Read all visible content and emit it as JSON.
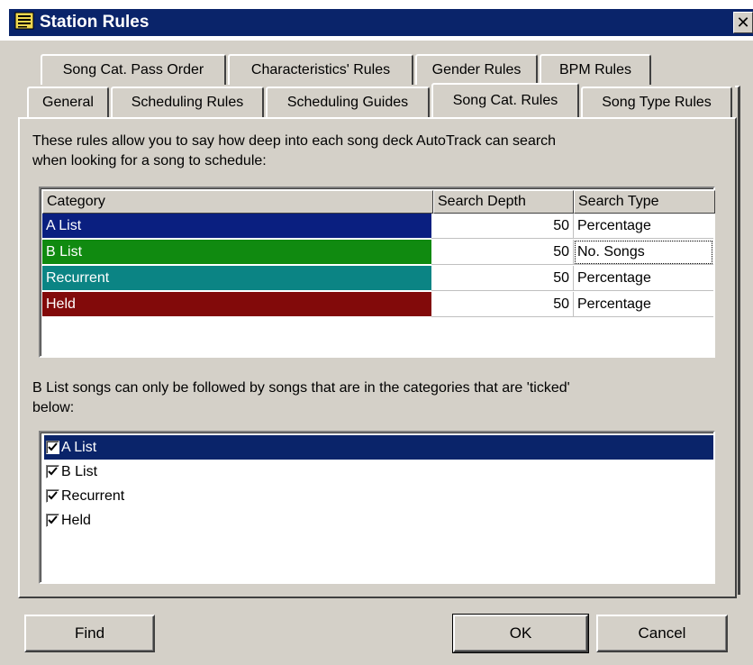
{
  "window": {
    "title": "Station Rules",
    "close_glyph": "✕"
  },
  "tabs_row1": [
    {
      "label": "Song Cat. Pass Order"
    },
    {
      "label": "Characteristics' Rules"
    },
    {
      "label": "Gender Rules"
    },
    {
      "label": "BPM Rules"
    }
  ],
  "tabs_row2": [
    {
      "label": "General"
    },
    {
      "label": "Scheduling Rules"
    },
    {
      "label": "Scheduling Guides"
    },
    {
      "label": "Song Cat. Rules",
      "active": true
    },
    {
      "label": "Song Type Rules"
    }
  ],
  "panel": {
    "description_line1": "These rules allow you to say how deep into each song deck AutoTrack can search",
    "description_line2": "when looking for a song to schedule:",
    "grid": {
      "columns": [
        "Category",
        "Search Depth",
        "Search Type"
      ],
      "rows": [
        {
          "category": "A List",
          "depth": "50",
          "type": "Percentage",
          "color": "#0a1f80"
        },
        {
          "category": "B List",
          "depth": "50",
          "type": "No. Songs",
          "color": "#108a10"
        },
        {
          "category": "Recurrent",
          "depth": "50",
          "type": "Percentage",
          "color": "#0b8484"
        },
        {
          "category": "Held",
          "depth": "50",
          "type": "Percentage",
          "color": "#820a0a"
        }
      ]
    },
    "follow_text_line1": "B List songs can only be followed by songs that are in the categories that are 'ticked'",
    "follow_text_line2": "below:",
    "follow_list": [
      {
        "label": "A List",
        "checked": true,
        "selected": true
      },
      {
        "label": "B List",
        "checked": true
      },
      {
        "label": "Recurrent",
        "checked": true
      },
      {
        "label": "Held",
        "checked": true
      }
    ]
  },
  "buttons": {
    "find": "Find",
    "ok": "OK",
    "cancel": "Cancel"
  },
  "colors": {
    "face": "#d4d0c8",
    "title_bar": "#0a246a",
    "selection": "#0a246a"
  }
}
